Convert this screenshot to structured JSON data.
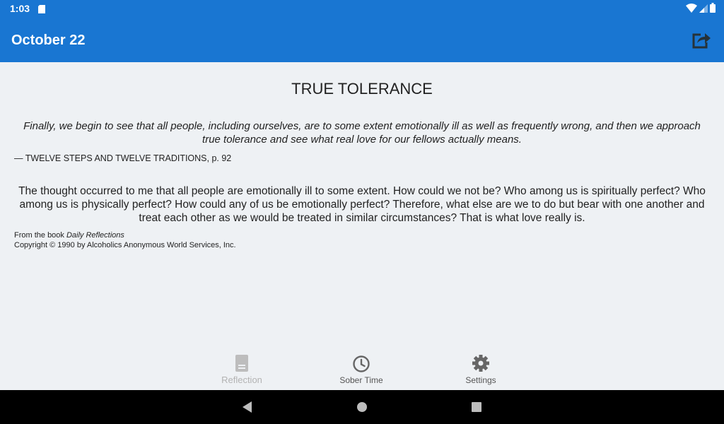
{
  "status_bar": {
    "time": "1:03",
    "icons": [
      "sd-card-icon",
      "wifi-icon",
      "signal-icon",
      "battery-icon"
    ]
  },
  "app_bar": {
    "title": "October 22",
    "share_icon": "share-icon",
    "color": "#1976d2"
  },
  "reflection": {
    "title": "TRUE TOLERANCE",
    "quote": "Finally, we begin to see that all people, including ourselves, are to some extent emotionally ill as well as frequently wrong, and then we approach true tolerance and see what real love for our fellows actually means.",
    "source": "— TWELVE STEPS AND TWELVE TRADITIONS, p. 92",
    "body": "The thought occurred to me that all people are emotionally ill to some extent. How could we not be? Who among us is spiritually perfect? Who among us is physically perfect? How could any of us be emotionally perfect? Therefore, what else are we to do but bear with one another and treat each other as we would be treated in similar circumstances? That is what love really is.",
    "footer_prefix": "From the book ",
    "footer_book": "Daily Reflections",
    "copyright": "Copyright © 1990 by Alcoholics Anonymous World Services, Inc."
  },
  "bottom_nav": {
    "items": [
      {
        "label": "Reflection",
        "icon": "book-icon",
        "active": false
      },
      {
        "label": "Sober Time",
        "icon": "clock-icon",
        "active": false
      },
      {
        "label": "Settings",
        "icon": "gear-icon",
        "active": false
      }
    ]
  },
  "system_nav": {
    "buttons": [
      "back-icon",
      "home-icon",
      "recents-icon"
    ]
  }
}
